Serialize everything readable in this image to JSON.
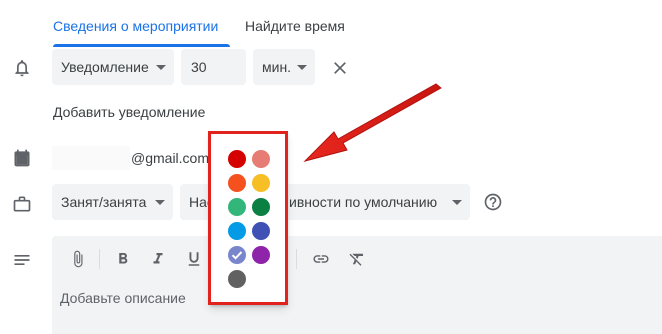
{
  "tabs": [
    {
      "label": "Сведения о мероприятии",
      "active": true
    },
    {
      "label": "Найдите время",
      "active": false
    }
  ],
  "notification": {
    "type": "Уведомление",
    "value": "30",
    "unit": "мин."
  },
  "add_notification_label": "Добавить уведомление",
  "calendar": {
    "email_suffix": "@gmail.com"
  },
  "availability": {
    "status": "Занят/занята",
    "visibility_visible_start": "Нас",
    "visibility_visible_end": "ивности по умолчанию"
  },
  "description": {
    "placeholder": "Добавьте описание"
  },
  "color_picker": {
    "colors": [
      {
        "name": "tomato",
        "hex": "#d50000"
      },
      {
        "name": "flamingo",
        "hex": "#e67c73"
      },
      {
        "name": "tangerine",
        "hex": "#f4511e"
      },
      {
        "name": "banana",
        "hex": "#f6bf26"
      },
      {
        "name": "sage",
        "hex": "#33b679"
      },
      {
        "name": "basil",
        "hex": "#0b8043"
      },
      {
        "name": "peacock",
        "hex": "#039be5"
      },
      {
        "name": "blueberry",
        "hex": "#3f51b5"
      },
      {
        "name": "lavender",
        "hex": "#7986cb",
        "selected": true
      },
      {
        "name": "grape",
        "hex": "#8e24aa"
      },
      {
        "name": "graphite",
        "hex": "#616161"
      }
    ]
  },
  "accent_color": "#1a73e8",
  "highlight_color": "#e0231c"
}
